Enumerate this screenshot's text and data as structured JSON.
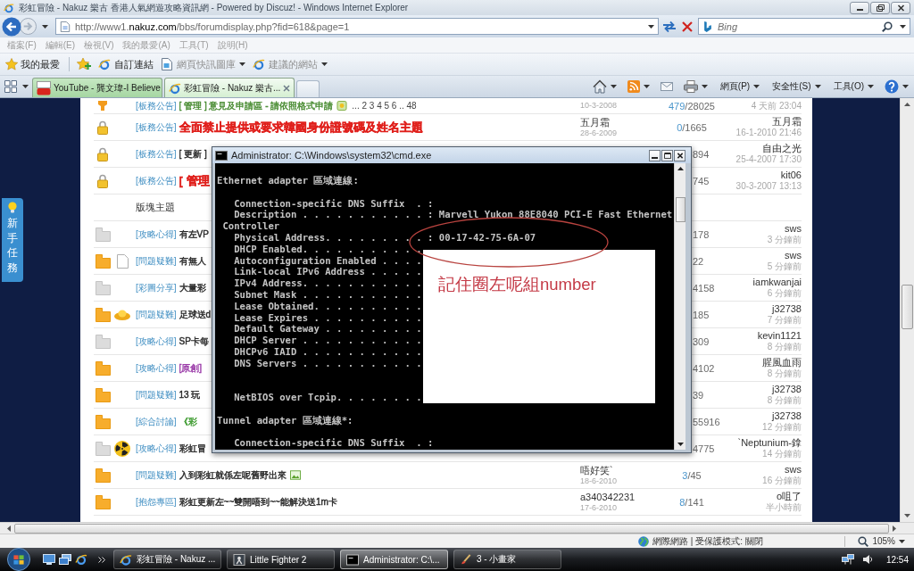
{
  "window": {
    "title": "彩虹冒險 - Nakuz 樂古 香港人氣網遊攻略資訊網 - Powered by Discuz! - Windows Internet Explorer"
  },
  "address_bar": {
    "url": {
      "scheme": "http://www1.",
      "domain": "nakuz.com",
      "path": "/bbs/forumdisplay.php?fid=618&page=1"
    },
    "search": {
      "placeholder": "Bing"
    }
  },
  "menu_bar": {
    "items": [
      "檔案(F)",
      "編輯(E)",
      "檢視(V)",
      "我的最愛(A)",
      "工具(T)",
      "說明(H)"
    ]
  },
  "favorites_bar": {
    "favorites": "我的最愛",
    "links": [
      {
        "kind": "ie",
        "label": "自訂連結",
        "dropdown": false,
        "disabled": false
      },
      {
        "kind": "gallery",
        "label": "網頁快訊圖庫",
        "dropdown": true,
        "disabled": true
      },
      {
        "kind": "ie",
        "label": "建議的網站",
        "dropdown": true,
        "disabled": true
      }
    ]
  },
  "tabs": [
    {
      "kind": "video",
      "label": "YouTube - 龔文瑋-I Believe",
      "selected": false
    },
    {
      "kind": "ie",
      "label": "彩虹冒險 - Nakuz 樂古...",
      "selected": true
    }
  ],
  "command_bar": {
    "menus": [
      "網頁(P)",
      "安全性(S)",
      "工具(O)"
    ]
  },
  "side_tab": {
    "label": "新手任務"
  },
  "forum": {
    "rows": [
      {
        "kind": "pinned",
        "tag": "[板務公告]",
        "title": "[ 管理 ] 意見及申請區 - 請依照格式申請",
        "color": "#468a2f",
        "bold": false,
        "attachment": {
          "kind": "emblem"
        },
        "pages": "... 2 3 4 5 6 .. 48",
        "date": "10-3-2008",
        "replies": "479",
        "views": "/28025",
        "last_time": "4 天前 23:04"
      },
      {
        "kind": "locked",
        "tag": "[板務公告]",
        "title": "全面禁止提供或要求韓國身份證號碼及姓名主題",
        "color": "#e0201c",
        "bold": true,
        "author": "五月霜",
        "date": "28-6-2009",
        "replies": "0",
        "views": "/1665",
        "last_by": "五月霜",
        "last_time": "16-1-2010 21:46"
      },
      {
        "kind": "locked",
        "tag": "[板務公告]",
        "title": "[ 更新 ]",
        "bold": false,
        "views": "894",
        "last_by": "自由之光",
        "last_time": "25-4-2007 17:30"
      },
      {
        "kind": "locked",
        "tag": "[板務公告]",
        "title": "[ 管理",
        "color": "#e0201c",
        "bold": true,
        "views": "745",
        "last_by": "kit06",
        "last_time": "30-3-2007 13:13"
      },
      {
        "kind": "section",
        "title": "版塊主題"
      },
      {
        "kind": "thread",
        "unread": false,
        "tag": "[攻略心得]",
        "title": "有左VP",
        "bold": false,
        "views": "178",
        "last_by": "sws",
        "last_time": "3 分鐘前"
      },
      {
        "kind": "thread",
        "unread": true,
        "badge": {
          "kind": "page"
        },
        "tag": "[問題疑難]",
        "title": "有無人",
        "bold": false,
        "views": "22",
        "last_by": "sws",
        "last_time": "5 分鐘前"
      },
      {
        "kind": "thread",
        "unread": false,
        "tag": "[彩圖分享]",
        "title": "大量彩",
        "bold": false,
        "views": "4158",
        "last_by": "iamkwanjai",
        "last_time": "6 分鐘前"
      },
      {
        "kind": "thread",
        "unread": true,
        "badge": {
          "kind": "ingot"
        },
        "tag": "[問題疑難]",
        "title": "足球送d",
        "bold": false,
        "views": "185",
        "last_by": "j32738",
        "last_time": "7 分鐘前"
      },
      {
        "kind": "thread",
        "unread": false,
        "tag": "[攻略心得]",
        "title": "SP卡每",
        "bold": false,
        "views": "309",
        "last_by": "kevin1121",
        "last_time": "8 分鐘前"
      },
      {
        "kind": "thread",
        "unread": true,
        "tag": "[攻略心得]",
        "title": "[原創]",
        "color": "#9a3aa8",
        "bold": false,
        "views": "4102",
        "last_by": "腥風血雨",
        "last_time": "8 分鐘前"
      },
      {
        "kind": "thread",
        "unread": true,
        "tag": "[問題疑難]",
        "title": "13 玩",
        "bold": false,
        "views": "39",
        "last_by": "j32738",
        "last_time": "8 分鐘前"
      },
      {
        "kind": "thread",
        "unread": true,
        "tag": "[綜合討論]",
        "title": "《彩",
        "color": "#3c9a2e",
        "bold": false,
        "views": "55916",
        "last_by": "j32738",
        "last_time": "12 分鐘前"
      },
      {
        "kind": "thread",
        "unread": false,
        "badge": {
          "kind": "radiation"
        },
        "tag": "[攻略心得]",
        "title": "彩虹冒",
        "bold": false,
        "views": "4775",
        "last_by": "`Neptunium-鎿",
        "last_time": "14 分鐘前"
      },
      {
        "kind": "thread",
        "unread": true,
        "tag": "[問題疑難]",
        "title": "入到彩虹就係左呢舊野出來",
        "bold": false,
        "attachment": {
          "kind": "image"
        },
        "author": "唔好笑`",
        "date": "18-6-2010",
        "replies": "3",
        "views": "/45",
        "last_by": "sws",
        "last_time": "16 分鐘前"
      },
      {
        "kind": "thread",
        "unread": true,
        "tag": "[抱怨專區]",
        "title": "彩虹更新左~~雙開唔到~~能解決送1m卡",
        "bold": false,
        "author": "a340342231",
        "date": "17-6-2010",
        "replies": "8",
        "views": "/141",
        "last_by": "o咀了",
        "last_time": "半小時前"
      }
    ]
  },
  "cmd_window": {
    "title": "Administrator: C:\\Windows\\system32\\cmd.exe",
    "output": "Ethernet adapter 區域連線:\n\n   Connection-specific DNS Suffix  . :\n   Description . . . . . . . . . . . : Marvell Yukon 88E8040 PCI-E Fast Ethernet\n Controller\n   Physical Address. . . . . . . . . : 00-17-42-75-6A-07\n   DHCP Enabled. . . . . . . . . . .\n   Autoconfiguration Enabled . . . .\n   Link-local IPv6 Address . . . . .\n   IPv4 Address. . . . . . . . . . .\n   Subnet Mask . . . . . . . . . . .\n   Lease Obtained. . . . . . . . . .\n   Lease Expires . . . . . . . . . .\n   Default Gateway . . . . . . . . .\n   DHCP Server . . . . . . . . . . .\n   DHCPv6 IAID . . . . . . . . . . .\n   DNS Servers . . . . . . . . . . .\n\n\n   NetBIOS over Tcpip. . . . . . . .\n\nTunnel adapter 區域連線*:\n\n   Connection-specific DNS Suffix  . :",
    "note": "記住圈左呢組number"
  },
  "status_bar": {
    "zone": "網際網路 | 受保護模式: 關閉",
    "zoom": "105%"
  },
  "taskbar": {
    "tasks": [
      {
        "kind": "ie",
        "label": "彩虹冒險 - Nakuz ...",
        "selected": false
      },
      {
        "kind": "game",
        "label": "Little Fighter 2",
        "selected": false
      },
      {
        "kind": "cmd",
        "label": "Administrator: C:\\...",
        "selected": true
      },
      {
        "kind": "paint",
        "label": "3 - 小畫家",
        "selected": false
      }
    ],
    "clock": "12:54"
  }
}
